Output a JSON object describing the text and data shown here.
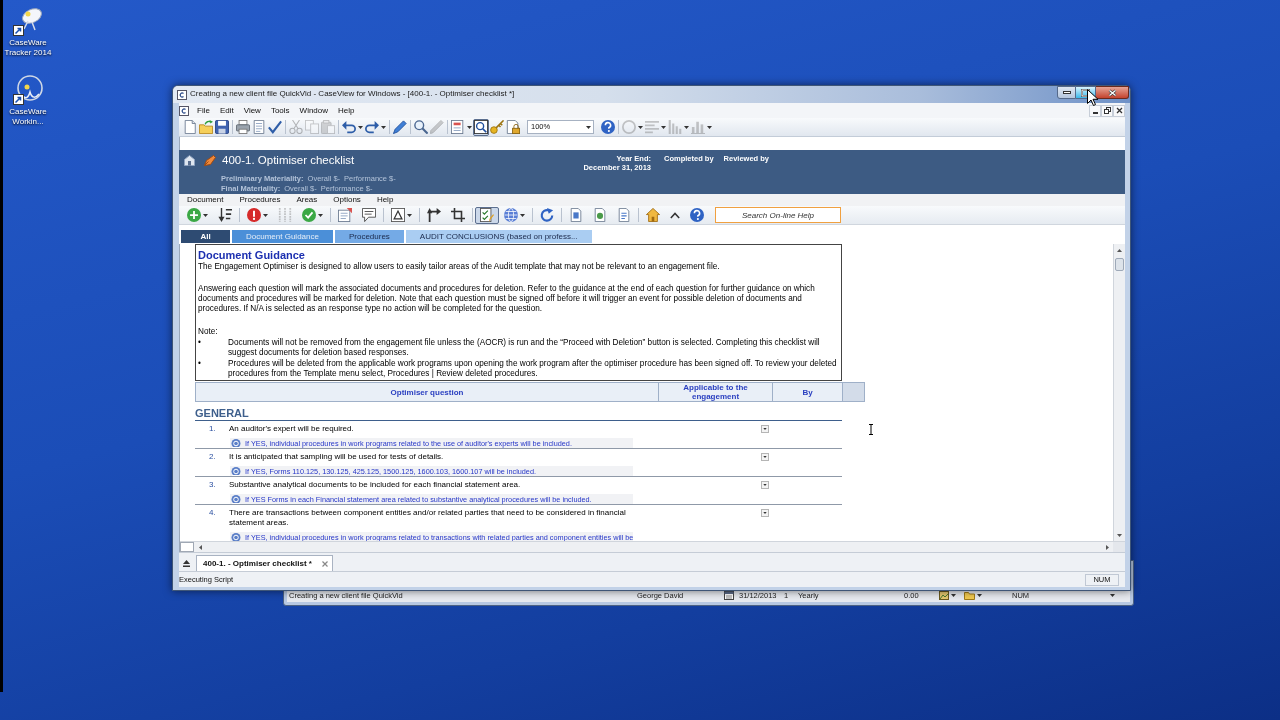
{
  "desktop_icons": [
    {
      "label": "CaseWare Tracker 2014"
    },
    {
      "label": "CaseWare Workin..."
    }
  ],
  "background_window": {
    "status": [
      "Creating a new client file QuickVid",
      "George David",
      "31/12/2013",
      "1",
      "Yearly",
      "0.00",
      "NUM"
    ]
  },
  "window": {
    "title": "Creating a new client file QuickVid - CaseView for Windows - [400-1. - Optimiser checklist *]",
    "controls": [
      {
        "kind": "minimize",
        "hovered": false
      },
      {
        "kind": "maximize",
        "hovered": true
      },
      {
        "kind": "close",
        "hovered": false
      }
    ]
  },
  "menu_bar": [
    "File",
    "Edit",
    "View",
    "Tools",
    "Window",
    "Help"
  ],
  "toolbar": {
    "groups": [
      {
        "buttons": [
          {
            "kind": "new",
            "disabled": false,
            "pressed": false,
            "dropdown": false
          },
          {
            "kind": "open",
            "disabled": false,
            "pressed": false,
            "dropdown": false
          },
          {
            "kind": "save",
            "disabled": false,
            "pressed": false,
            "dropdown": false
          }
        ]
      },
      {
        "buttons": [
          {
            "kind": "print",
            "disabled": false,
            "pressed": false,
            "dropdown": false
          },
          {
            "kind": "preview",
            "disabled": false,
            "pressed": false,
            "dropdown": false
          },
          {
            "kind": "spelling",
            "disabled": false,
            "pressed": false,
            "dropdown": false
          }
        ]
      },
      {
        "buttons": [
          {
            "kind": "cut",
            "disabled": true,
            "pressed": false,
            "dropdown": false
          },
          {
            "kind": "copy",
            "disabled": true,
            "pressed": false,
            "dropdown": false
          },
          {
            "kind": "paste",
            "disabled": true,
            "pressed": false,
            "dropdown": false
          }
        ]
      },
      {
        "buttons": [
          {
            "kind": "undo",
            "disabled": false,
            "pressed": false,
            "dropdown": true
          },
          {
            "kind": "redo",
            "disabled": false,
            "pressed": false,
            "dropdown": true
          }
        ]
      },
      {
        "buttons": [
          {
            "kind": "pencil",
            "disabled": false,
            "pressed": false,
            "dropdown": false
          }
        ]
      },
      {
        "buttons": [
          {
            "kind": "find",
            "disabled": false,
            "pressed": false,
            "dropdown": false
          },
          {
            "kind": "marker",
            "disabled": true,
            "pressed": false,
            "dropdown": false
          }
        ]
      },
      {
        "buttons": [
          {
            "kind": "form",
            "disabled": false,
            "pressed": false,
            "dropdown": true
          },
          {
            "kind": "inspect",
            "disabled": false,
            "pressed": true,
            "dropdown": false
          },
          {
            "kind": "key",
            "disabled": false,
            "pressed": false,
            "dropdown": false
          },
          {
            "kind": "protect",
            "disabled": false,
            "pressed": false,
            "dropdown": false
          },
          {
            "kind": "zoom",
            "value": "100%"
          },
          {
            "kind": "help",
            "disabled": false,
            "pressed": false,
            "dropdown": false
          }
        ]
      },
      {
        "buttons": [
          {
            "kind": "circle",
            "disabled": true,
            "pressed": false,
            "dropdown": true
          },
          {
            "kind": "script",
            "disabled": true,
            "pressed": false,
            "dropdown": true
          },
          {
            "kind": "levels",
            "disabled": true,
            "pressed": false,
            "dropdown": true
          },
          {
            "kind": "chart",
            "disabled": true,
            "pressed": false,
            "dropdown": true
          }
        ]
      }
    ]
  },
  "document_header": {
    "title": "400-1. Optimiser checklist",
    "materiality": [
      {
        "label": "Preliminary Materiality:",
        "overall": "Overall $-",
        "performance": "Performance $-"
      },
      {
        "label": "Final Materiality:",
        "overall": "Overall $-",
        "performance": "Performance $-"
      }
    ],
    "year_end": {
      "label": "Year End:",
      "value": "December 31, 2013"
    },
    "signoffs": [
      "Completed by",
      "Reviewed by"
    ]
  },
  "document_menu": [
    "Document",
    "Procedures",
    "Areas",
    "Options",
    "Help"
  ],
  "document_toolbar": {
    "groups": [
      {
        "buttons": [
          {
            "kind": "add",
            "disabled": false,
            "pressed": false,
            "dropdown": true
          },
          {
            "kind": "sort",
            "disabled": false,
            "pressed": false,
            "dropdown": false
          }
        ]
      },
      {
        "buttons": [
          {
            "kind": "alert",
            "disabled": false,
            "pressed": false,
            "dropdown": true
          },
          {
            "kind": "split",
            "disabled": true,
            "pressed": false,
            "dropdown": false
          },
          {
            "kind": "approve",
            "disabled": false,
            "pressed": false,
            "dropdown": true
          }
        ]
      },
      {
        "buttons": [
          {
            "kind": "note",
            "disabled": false,
            "pressed": false,
            "dropdown": false
          },
          {
            "kind": "comment",
            "disabled": false,
            "pressed": false,
            "dropdown": false
          }
        ]
      },
      {
        "buttons": [
          {
            "kind": "font",
            "disabled": false,
            "pressed": false,
            "dropdown": true
          }
        ]
      },
      {
        "buttons": [
          {
            "kind": "corner",
            "disabled": false,
            "pressed": false,
            "dropdown": false
          },
          {
            "kind": "crop",
            "disabled": false,
            "pressed": false,
            "dropdown": false
          }
        ]
      },
      {
        "buttons": [
          {
            "kind": "checklist",
            "disabled": false,
            "pressed": true,
            "dropdown": false
          },
          {
            "kind": "globe",
            "disabled": false,
            "pressed": false,
            "dropdown": true
          }
        ]
      },
      {
        "buttons": [
          {
            "kind": "refresh",
            "disabled": false,
            "pressed": false,
            "dropdown": false
          }
        ]
      },
      {
        "buttons": [
          {
            "kind": "page",
            "disabled": false,
            "pressed": false,
            "dropdown": false
          },
          {
            "kind": "money",
            "disabled": false,
            "pressed": false,
            "dropdown": false
          },
          {
            "kind": "report",
            "disabled": false,
            "pressed": false,
            "dropdown": false
          }
        ]
      },
      {
        "buttons": [
          {
            "kind": "home",
            "disabled": false,
            "pressed": false,
            "dropdown": false
          },
          {
            "kind": "up",
            "disabled": false,
            "pressed": false,
            "dropdown": false
          },
          {
            "kind": "question",
            "disabled": false,
            "pressed": false,
            "dropdown": false
          }
        ]
      }
    ],
    "search": {
      "placeholder": "Search On-line Help"
    }
  },
  "tabs": [
    {
      "label": "All",
      "selected": true,
      "color": "#2e4b72"
    },
    {
      "label": "Document Guidance",
      "selected": false,
      "color": "#4b8fd8"
    },
    {
      "label": "Procedures",
      "selected": false,
      "color": "#74aae6"
    },
    {
      "label": "AUDIT CONCLUSIONS (based on profess...",
      "selected": false,
      "color": "#aacdf2"
    }
  ],
  "guidance": {
    "heading": "Document Guidance",
    "paragraphs": [
      "The Engagement Optimiser is designed to allow users to easily tailor areas of the Audit template that may not be relevant to an engagement file.",
      "Answering each question will mark the associated documents and procedures for deletion. Refer to the guidance at the end of each question for further guidance on which documents and procedures will be marked for deletion. Note that each question must be signed off before it will trigger an event for possible deletion of documents and procedures. If N/A is selected as an response type no action will be completed for the question."
    ],
    "note": "Note:",
    "bullets": [
      {
        "marker": "•",
        "text": "Documents will not be removed from the engagement file unless the (AOCR) is run and the “Proceed with Deletion” button is selected. Completing this checklist will suggest documents for deletion based responses."
      },
      {
        "marker": "•",
        "text": "Procedures will be deleted from the applicable work programs upon opening the work program after the optimiser procedure has been signed off. To review your deleted procedures from the Template menu select, Procedures | Review deleted procedures."
      }
    ]
  },
  "checklist": {
    "columns": [
      "Optimiser question",
      "Applicable to the engagement",
      "By"
    ],
    "section": "GENERAL",
    "questions": [
      {
        "number": "1.",
        "text": "An auditor's expert will be required.",
        "guidance": "If YES, individual procedures in work programs related to the use of auditor's experts will be included."
      },
      {
        "number": "2.",
        "text": "It is anticipated that sampling will be used for tests of details.",
        "guidance": "If YES, Forms 110.125, 130.125, 425.125, 1500.125, 1600.103, 1600.107 will be included."
      },
      {
        "number": "3.",
        "text": "Substantive analytical documents to be included for each financial statement area.",
        "guidance": "If YES Forms in each Financial statement area related to substantive analytical procedures will be included."
      },
      {
        "number": "4.",
        "text": "There are transactions between component entities and/or related parties that need to be considered in financial statement areas.",
        "guidance": "If YES, individual procedures in work programs related to transactions with related parties and component entities will be"
      }
    ]
  },
  "document_tabs": [
    {
      "label": "400-1. - Optimiser checklist *",
      "selected": true
    }
  ],
  "status_bar": {
    "message": "Executing Script",
    "indicator": "NUM"
  }
}
